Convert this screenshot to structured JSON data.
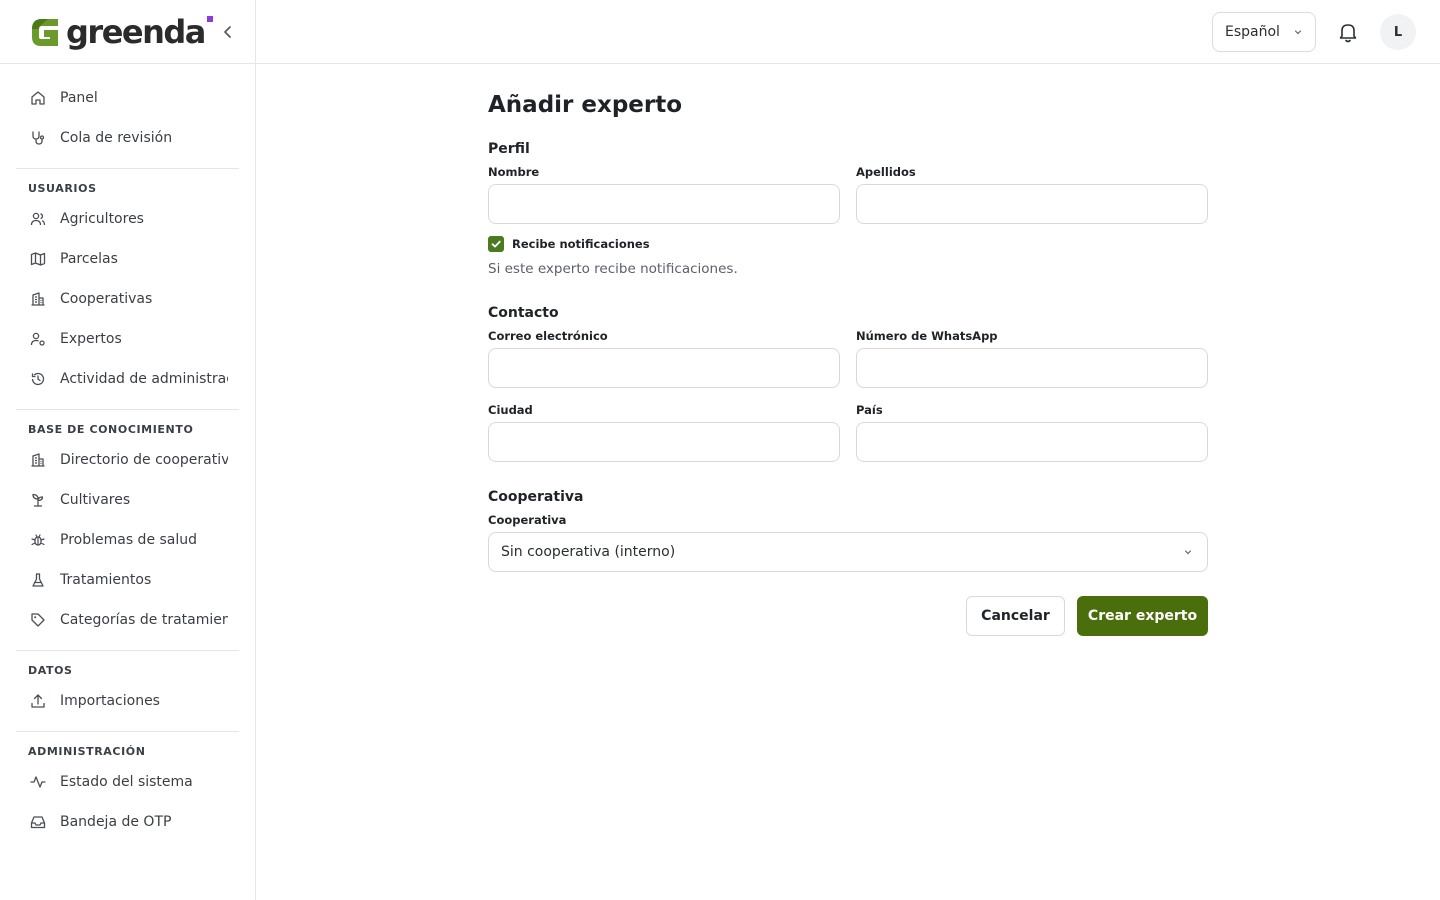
{
  "brand": {
    "name": "greenda",
    "accent": "#4a7c1f",
    "dot_color": "#8b3dd9"
  },
  "sidebar": {
    "top_items": [
      {
        "label": "Panel",
        "icon": "home-icon"
      },
      {
        "label": "Cola de revisión",
        "icon": "stethoscope-icon"
      }
    ],
    "sections": [
      {
        "title": "USUARIOS",
        "items": [
          {
            "label": "Agricultores",
            "icon": "users-icon"
          },
          {
            "label": "Parcelas",
            "icon": "map-icon"
          },
          {
            "label": "Cooperativas",
            "icon": "building-icon"
          },
          {
            "label": "Expertos",
            "icon": "user-cog-icon"
          },
          {
            "label": "Actividad de administración",
            "icon": "history-icon"
          }
        ]
      },
      {
        "title": "BASE DE CONOCIMIENTO",
        "items": [
          {
            "label": "Directorio de cooperativas",
            "icon": "building-icon"
          },
          {
            "label": "Cultivares",
            "icon": "sprout-icon"
          },
          {
            "label": "Problemas de salud",
            "icon": "bug-icon"
          },
          {
            "label": "Tratamientos",
            "icon": "flask-icon"
          },
          {
            "label": "Categorías de tratamiento",
            "icon": "tag-icon"
          }
        ]
      },
      {
        "title": "DATOS",
        "items": [
          {
            "label": "Importaciones",
            "icon": "upload-icon"
          }
        ]
      },
      {
        "title": "ADMINISTRACIÓN",
        "items": [
          {
            "label": "Estado del sistema",
            "icon": "activity-icon"
          },
          {
            "label": "Bandeja de OTP",
            "icon": "inbox-icon"
          }
        ]
      }
    ]
  },
  "topbar": {
    "language": "Español",
    "avatar_initial": "L"
  },
  "form": {
    "title": "Añadir experto",
    "profile": {
      "section": "Perfil",
      "first_name_label": "Nombre",
      "first_name_value": "",
      "last_name_label": "Apellidos",
      "last_name_value": "",
      "notify_label": "Recibe notificaciones",
      "notify_checked": true,
      "notify_hint": "Si este experto recibe notificaciones."
    },
    "contact": {
      "section": "Contacto",
      "email_label": "Correo electrónico",
      "email_value": "",
      "whatsapp_label": "Número de WhatsApp",
      "whatsapp_value": "",
      "city_label": "Ciudad",
      "city_value": "",
      "country_label": "País",
      "country_value": ""
    },
    "cooperative": {
      "section": "Cooperativa",
      "label": "Cooperativa",
      "selected": "Sin cooperativa (interno)"
    },
    "cancel_label": "Cancelar",
    "submit_label": "Crear experto"
  }
}
